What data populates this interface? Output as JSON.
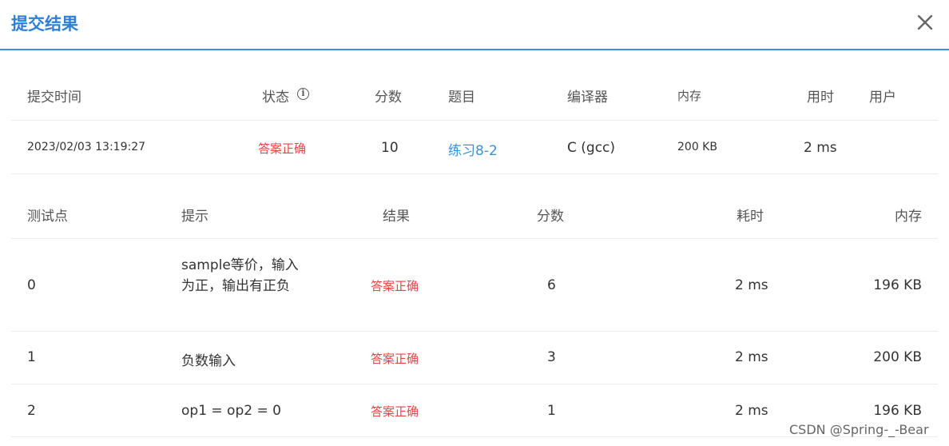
{
  "dialog": {
    "title": "提交结果"
  },
  "summary": {
    "headers": {
      "time": "提交时间",
      "status": "状态",
      "score": "分数",
      "problem": "题目",
      "compiler": "编译器",
      "memory": "内存",
      "duration": "用时",
      "user": "用户"
    },
    "row": {
      "time": "2023/02/03 13:19:27",
      "status": "答案正确",
      "score": "10",
      "problem": "练习8-2",
      "compiler": "C (gcc)",
      "memory": "200 KB",
      "duration": "2 ms",
      "user": ""
    }
  },
  "tests": {
    "headers": {
      "case": "测试点",
      "hint": "提示",
      "result": "结果",
      "score": "分数",
      "time": "耗时",
      "memory": "内存"
    },
    "rows": [
      {
        "case": "0",
        "hint": "sample等价，输入为正，输出有正负",
        "result": "答案正确",
        "score": "6",
        "time": "2 ms",
        "memory": "196 KB"
      },
      {
        "case": "1",
        "hint": "负数输入",
        "result": "答案正确",
        "score": "3",
        "time": "2 ms",
        "memory": "200 KB"
      },
      {
        "case": "2",
        "hint": "op1 = op2 = 0",
        "result": "答案正确",
        "score": "1",
        "time": "2 ms",
        "memory": "196 KB"
      }
    ]
  },
  "watermark": "CSDN @Spring-_-Bear",
  "colors": {
    "accent": "#3c8fdc",
    "success_text": "#e54545"
  },
  "icons": {
    "close": "close-icon",
    "info": "info-icon"
  }
}
